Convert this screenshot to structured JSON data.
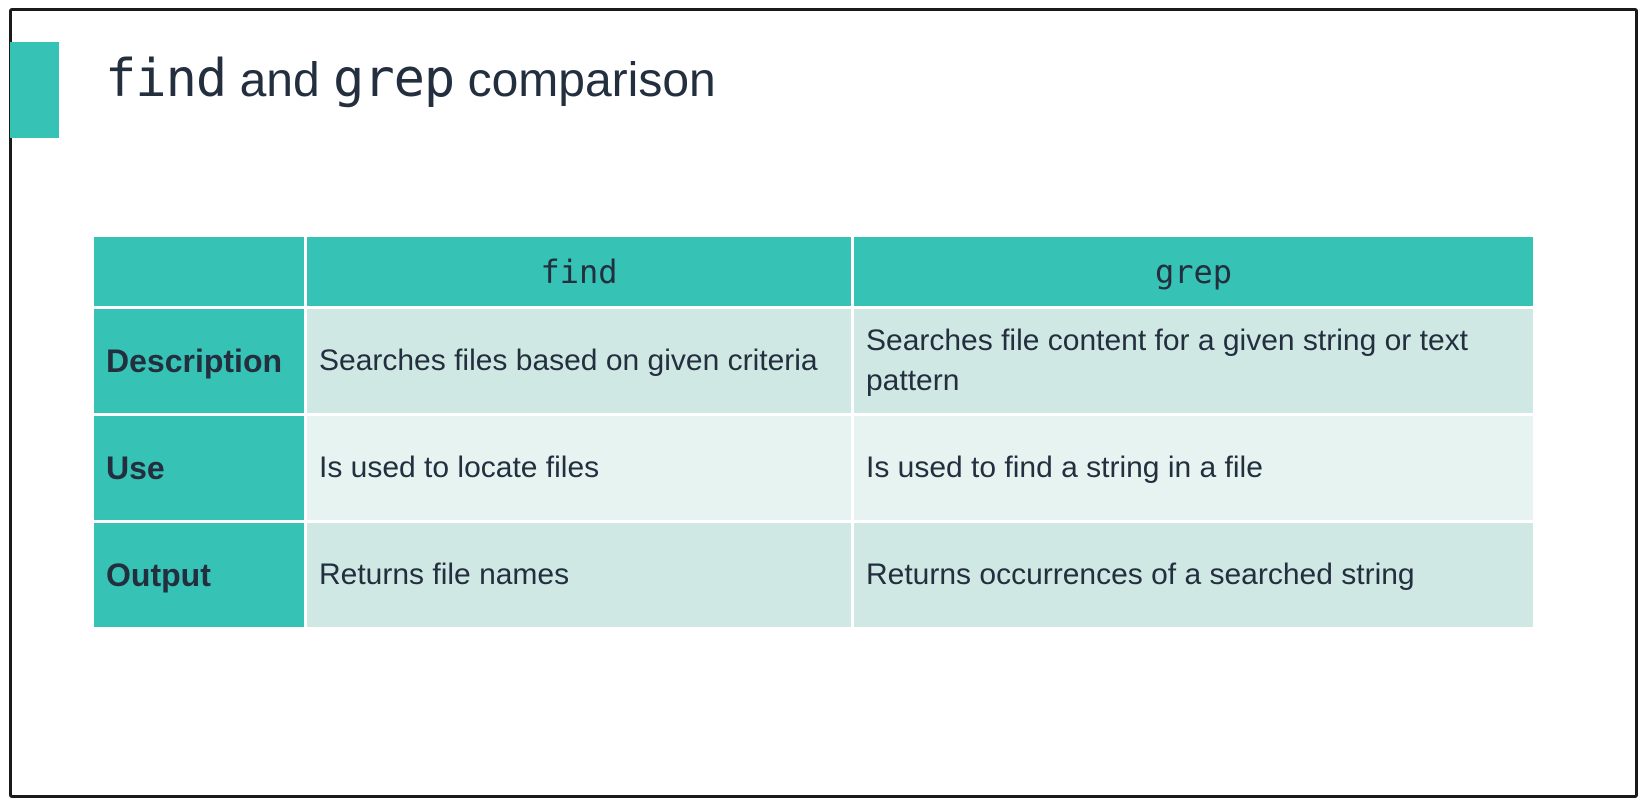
{
  "title": {
    "word1": "find",
    "connector": "and",
    "word2": "grep",
    "suffix": "comparison"
  },
  "table": {
    "headers": [
      "",
      "find",
      "grep"
    ],
    "rows": [
      {
        "label": "Description",
        "find": "Searches files based on given criteria",
        "grep": "Searches file content for a given string or text pattern"
      },
      {
        "label": "Use",
        "find": "Is used to locate files",
        "grep": "Is used to find a string in a file"
      },
      {
        "label": "Output",
        "find": "Returns file names",
        "grep": "Returns occurrences of a searched string"
      }
    ]
  },
  "colors": {
    "accent": "#36c2b4",
    "row_dark": "#cfe8e4",
    "row_light": "#e6f3f1",
    "text": "#232f3e"
  }
}
